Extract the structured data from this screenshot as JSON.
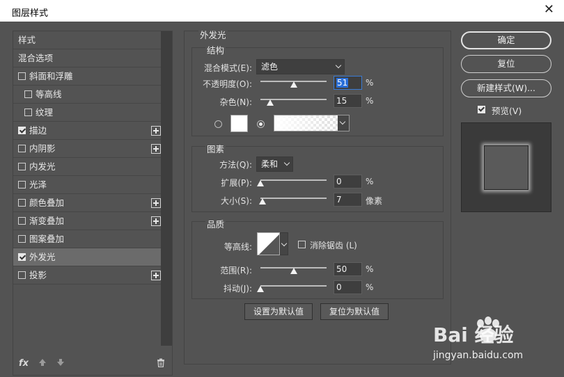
{
  "window": {
    "title": "图层样式",
    "close_glyph": "✕"
  },
  "sidebar": {
    "items": [
      {
        "label": "样式",
        "checkbox": false,
        "checked": false,
        "plus": false,
        "indent": 0,
        "selected": false
      },
      {
        "label": "混合选项",
        "checkbox": false,
        "checked": false,
        "plus": false,
        "indent": 0,
        "selected": false
      },
      {
        "label": "斜面和浮雕",
        "checkbox": true,
        "checked": false,
        "plus": false,
        "indent": 0,
        "selected": false
      },
      {
        "label": "等高线",
        "checkbox": true,
        "checked": false,
        "plus": false,
        "indent": 1,
        "selected": false
      },
      {
        "label": "纹理",
        "checkbox": true,
        "checked": false,
        "plus": false,
        "indent": 1,
        "selected": false
      },
      {
        "label": "描边",
        "checkbox": true,
        "checked": true,
        "plus": true,
        "indent": 0,
        "selected": false
      },
      {
        "label": "内阴影",
        "checkbox": true,
        "checked": false,
        "plus": true,
        "indent": 0,
        "selected": false
      },
      {
        "label": "内发光",
        "checkbox": true,
        "checked": false,
        "plus": false,
        "indent": 0,
        "selected": false
      },
      {
        "label": "光泽",
        "checkbox": true,
        "checked": false,
        "plus": false,
        "indent": 0,
        "selected": false
      },
      {
        "label": "颜色叠加",
        "checkbox": true,
        "checked": false,
        "plus": true,
        "indent": 0,
        "selected": false
      },
      {
        "label": "渐变叠加",
        "checkbox": true,
        "checked": false,
        "plus": true,
        "indent": 0,
        "selected": false
      },
      {
        "label": "图案叠加",
        "checkbox": true,
        "checked": false,
        "plus": false,
        "indent": 0,
        "selected": false
      },
      {
        "label": "外发光",
        "checkbox": true,
        "checked": true,
        "plus": false,
        "indent": 0,
        "selected": true
      },
      {
        "label": "投影",
        "checkbox": true,
        "checked": false,
        "plus": true,
        "indent": 0,
        "selected": false
      }
    ],
    "tools": {
      "fx": "fx",
      "up_icon": "arrow-up-icon",
      "down_icon": "arrow-down-icon",
      "trash_icon": "trash-icon"
    }
  },
  "panel": {
    "title": "外发光",
    "structure": {
      "title": "结构",
      "blend_mode_label": "混合模式(E):",
      "blend_mode_value": "滤色",
      "opacity_label": "不透明度(O):",
      "opacity_value": "51",
      "opacity_unit": "%",
      "opacity_level": 51,
      "noise_label": "杂色(N):",
      "noise_value": "15",
      "noise_unit": "%",
      "noise_level": 15
    },
    "elements": {
      "title": "图素",
      "technique_label": "方法(Q):",
      "technique_value": "柔和",
      "spread_label": "扩展(P):",
      "spread_value": "0",
      "spread_unit": "%",
      "spread_level": 0,
      "size_label": "大小(S):",
      "size_value": "7",
      "size_unit": "像素",
      "size_level": 3
    },
    "quality": {
      "title": "品质",
      "contour_label": "等高线:",
      "antialias_label": "消除锯齿 (L)",
      "range_label": "范围(R):",
      "range_value": "50",
      "range_unit": "%",
      "range_level": 50,
      "jitter_label": "抖动(J):",
      "jitter_value": "0",
      "jitter_unit": "%",
      "jitter_level": 0
    },
    "make_default": "设置为默认值",
    "reset_default": "复位为默认值"
  },
  "actions": {
    "ok": "确定",
    "reset": "复位",
    "new_style": "新建样式(W)...",
    "preview_label": "预览(V)"
  },
  "watermark": {
    "brand": "Bai 经验",
    "url": "jingyan.baidu.com"
  }
}
